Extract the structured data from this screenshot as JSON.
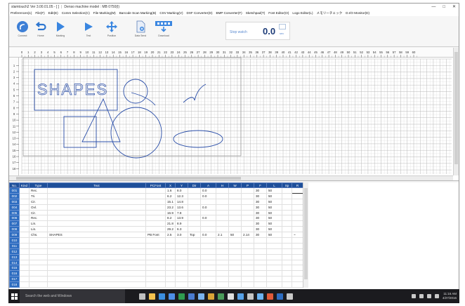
{
  "window": {
    "title": "slamtouch2  Ver 3.00.01.05  -  [ ]",
    "model": "Denso machine model : MB 0750(I)",
    "controls": [
      "—",
      "□",
      "✕"
    ]
  },
  "menu": [
    "Preferences(1)",
    "File(F)",
    "Edit(E)",
    "Comm Selection(C)",
    "File Marking(M)",
    "Barcode Scan Marking(B)",
    "CSV Marking(V)",
    "DXF Converter(D)",
    "BMP Converter(F)",
    "Sketchpad(T)",
    "Font Editor(O)",
    "Logo Editor(L)",
    "メモリーチェック",
    "D.I/O Monitor(D)"
  ],
  "toolbar": [
    {
      "name": "connect",
      "label": "Connect",
      "icon": "signal-icon"
    },
    {
      "name": "home",
      "label": "Home",
      "icon": "return-icon"
    },
    {
      "name": "marking",
      "label": "Marking",
      "icon": "play-icon"
    },
    {
      "name": "test",
      "label": "Test",
      "icon": "play-icon"
    },
    {
      "name": "position",
      "label": "Position",
      "icon": "move-icon"
    },
    {
      "name": "data-send",
      "label": "Data Send",
      "icon": "document-icon"
    },
    {
      "name": "download",
      "label": "Download",
      "icon": "download-icon"
    }
  ],
  "stopwatch": {
    "label": "Stop watch",
    "value": "0.0",
    "unit": "sec"
  },
  "canvas": {
    "text": "SHAPES",
    "ruler_top": [
      "0",
      "1",
      "2",
      "3",
      "4",
      "5",
      "6",
      "7",
      "8",
      "9",
      "10",
      "11",
      "12",
      "13",
      "14",
      "15",
      "16",
      "17",
      "18",
      "19",
      "20",
      "21",
      "22",
      "23",
      "24",
      "25",
      "26",
      "27",
      "28",
      "29",
      "30",
      "31",
      "32",
      "33",
      "34",
      "35",
      "36",
      "37",
      "38",
      "39",
      "40",
      "41",
      "42",
      "43",
      "44",
      "45",
      "46",
      "47",
      "48",
      "49",
      "50",
      "51",
      "52",
      "53",
      "54",
      "55",
      "56",
      "57",
      "58",
      "59",
      "60"
    ],
    "ruler_left": [
      "1",
      "2",
      "3",
      "4",
      "5",
      "6",
      "7",
      "8",
      "9",
      "10",
      "11",
      "12",
      "13",
      "14",
      "15",
      "16",
      "17",
      "18",
      "19"
    ]
  },
  "table": {
    "headers": [
      "No.",
      "Kind",
      "Type",
      "Text",
      "PCFont",
      "X",
      "Y",
      "Dir",
      "A",
      "H",
      "W",
      "P",
      "F",
      "L",
      "Sp",
      "R"
    ],
    "rows": [
      {
        "no": "001",
        "kind": "",
        "type": "Rec.",
        "text": "",
        "font": "",
        "x": "1.6",
        "y": "8.0",
        "dir": "",
        "a": "0.0",
        "h": "",
        "w": "",
        "p": "",
        "f": "30",
        "l": "50",
        "sp": "",
        "r": ""
      },
      {
        "no": "002",
        "kind": "",
        "type": "Tri.",
        "text": "",
        "font": "",
        "x": "6.2",
        "y": "12.3",
        "dir": "",
        "a": "0.0",
        "h": "",
        "w": "",
        "p": "",
        "f": "30",
        "l": "50",
        "sp": "",
        "r": ""
      },
      {
        "no": "003",
        "kind": "",
        "type": "Cir.",
        "text": "",
        "font": "",
        "x": "15.1",
        "y": "14.8",
        "dir": "",
        "a": "",
        "h": "",
        "w": "",
        "p": "",
        "f": "30",
        "l": "50",
        "sp": "",
        "r": ""
      },
      {
        "no": "004",
        "kind": "",
        "type": "Ovl.",
        "text": "",
        "font": "",
        "x": "23.2",
        "y": "13.6",
        "dir": "",
        "a": "0.0",
        "h": "",
        "w": "",
        "p": "",
        "f": "30",
        "l": "50",
        "sp": "",
        "r": ""
      },
      {
        "no": "005",
        "kind": "",
        "type": "Cir.",
        "text": "",
        "font": "",
        "x": "16.9",
        "y": "7.8",
        "dir": "",
        "a": "",
        "h": "",
        "w": "",
        "p": "",
        "f": "30",
        "l": "50",
        "sp": "",
        "r": ""
      },
      {
        "no": "006",
        "kind": "",
        "type": "Rec.",
        "text": "",
        "font": "",
        "x": "8.2",
        "y": "13.9",
        "dir": "",
        "a": "0.0",
        "h": "",
        "w": "",
        "p": "",
        "f": "30",
        "l": "50",
        "sp": "",
        "r": ""
      },
      {
        "no": "007",
        "kind": "",
        "type": "Lin.",
        "text": "",
        "font": "",
        "x": "21.8",
        "y": "8.9",
        "dir": "",
        "a": "",
        "h": "",
        "w": "",
        "p": "",
        "f": "30",
        "l": "50",
        "sp": "",
        "r": ""
      },
      {
        "no": "008",
        "kind": "",
        "type": "Lin.",
        "text": "",
        "font": "",
        "x": "29.2",
        "y": "6.3",
        "dir": "",
        "a": "",
        "h": "",
        "w": "",
        "p": "",
        "f": "30",
        "l": "50",
        "sp": "",
        "r": ""
      },
      {
        "no": "009",
        "kind": "",
        "type": "Chs.",
        "text": "SHAPES",
        "font": "PB Font",
        "x": "2.5",
        "y": "3.0",
        "dir": "Top",
        "a": "0.0",
        "h": "2.1",
        "w": "50",
        "p": "2.14",
        "f": "30",
        "l": "50",
        "sp": "",
        "r": "~"
      },
      {
        "no": "010",
        "kind": "",
        "type": "",
        "text": "",
        "font": "",
        "x": "",
        "y": "",
        "dir": "",
        "a": "",
        "h": "",
        "w": "",
        "p": "",
        "f": "",
        "l": "",
        "sp": "",
        "r": ""
      },
      {
        "no": "011",
        "kind": "",
        "type": "",
        "text": "",
        "font": "",
        "x": "",
        "y": "",
        "dir": "",
        "a": "",
        "h": "",
        "w": "",
        "p": "",
        "f": "",
        "l": "",
        "sp": "",
        "r": ""
      },
      {
        "no": "012",
        "kind": "",
        "type": "",
        "text": "",
        "font": "",
        "x": "",
        "y": "",
        "dir": "",
        "a": "",
        "h": "",
        "w": "",
        "p": "",
        "f": "",
        "l": "",
        "sp": "",
        "r": ""
      },
      {
        "no": "013",
        "kind": "",
        "type": "",
        "text": "",
        "font": "",
        "x": "",
        "y": "",
        "dir": "",
        "a": "",
        "h": "",
        "w": "",
        "p": "",
        "f": "",
        "l": "",
        "sp": "",
        "r": ""
      },
      {
        "no": "014",
        "kind": "",
        "type": "",
        "text": "",
        "font": "",
        "x": "",
        "y": "",
        "dir": "",
        "a": "",
        "h": "",
        "w": "",
        "p": "",
        "f": "",
        "l": "",
        "sp": "",
        "r": ""
      },
      {
        "no": "015",
        "kind": "",
        "type": "",
        "text": "",
        "font": "",
        "x": "",
        "y": "",
        "dir": "",
        "a": "",
        "h": "",
        "w": "",
        "p": "",
        "f": "",
        "l": "",
        "sp": "",
        "r": ""
      },
      {
        "no": "016",
        "kind": "",
        "type": "",
        "text": "",
        "font": "",
        "x": "",
        "y": "",
        "dir": "",
        "a": "",
        "h": "",
        "w": "",
        "p": "",
        "f": "",
        "l": "",
        "sp": "",
        "r": ""
      },
      {
        "no": "017",
        "kind": "",
        "type": "",
        "text": "",
        "font": "",
        "x": "",
        "y": "",
        "dir": "",
        "a": "",
        "h": "",
        "w": "",
        "p": "",
        "f": "",
        "l": "",
        "sp": "",
        "r": ""
      },
      {
        "no": "018",
        "kind": "",
        "type": "",
        "text": "",
        "font": "",
        "x": "",
        "y": "",
        "dir": "",
        "a": "",
        "h": "",
        "w": "",
        "p": "",
        "f": "",
        "l": "",
        "sp": "",
        "r": ""
      }
    ]
  },
  "taskbar": {
    "search_placeholder": "Search the web and Windows",
    "time": "11:16 AM",
    "date": "4/27/2016",
    "apps": [
      {
        "name": "task-view-icon",
        "color": "#bfbfbf"
      },
      {
        "name": "file-explorer-icon",
        "color": "#f2c14e"
      },
      {
        "name": "edge-icon",
        "color": "#3b8ee0"
      },
      {
        "name": "store-icon",
        "color": "#4d8fe8"
      },
      {
        "name": "excel-icon",
        "color": "#2e9b4f"
      },
      {
        "name": "app-icon",
        "color": "#4a7bd0"
      },
      {
        "name": "app-icon",
        "color": "#7ab4f0"
      },
      {
        "name": "app-icon",
        "color": "#d9a437"
      },
      {
        "name": "app-icon",
        "color": "#4a9c5a"
      },
      {
        "name": "app-icon",
        "color": "#e0e0e0"
      },
      {
        "name": "app-icon",
        "color": "#56a0e6"
      },
      {
        "name": "app-icon",
        "color": "#c4c4c4"
      },
      {
        "name": "app-icon",
        "color": "#6bb3f2"
      },
      {
        "name": "app-icon",
        "color": "#e05a3a"
      },
      {
        "name": "app-icon",
        "color": "#2d6cc0"
      },
      {
        "name": "app-icon",
        "color": "#c8c8c8"
      }
    ]
  },
  "colors": {
    "accent": "#1e4f9a",
    "shape_stroke": "#2a4ea8",
    "grid_major": "#b5b5b5",
    "grid_minor": "#e2e2e2"
  }
}
